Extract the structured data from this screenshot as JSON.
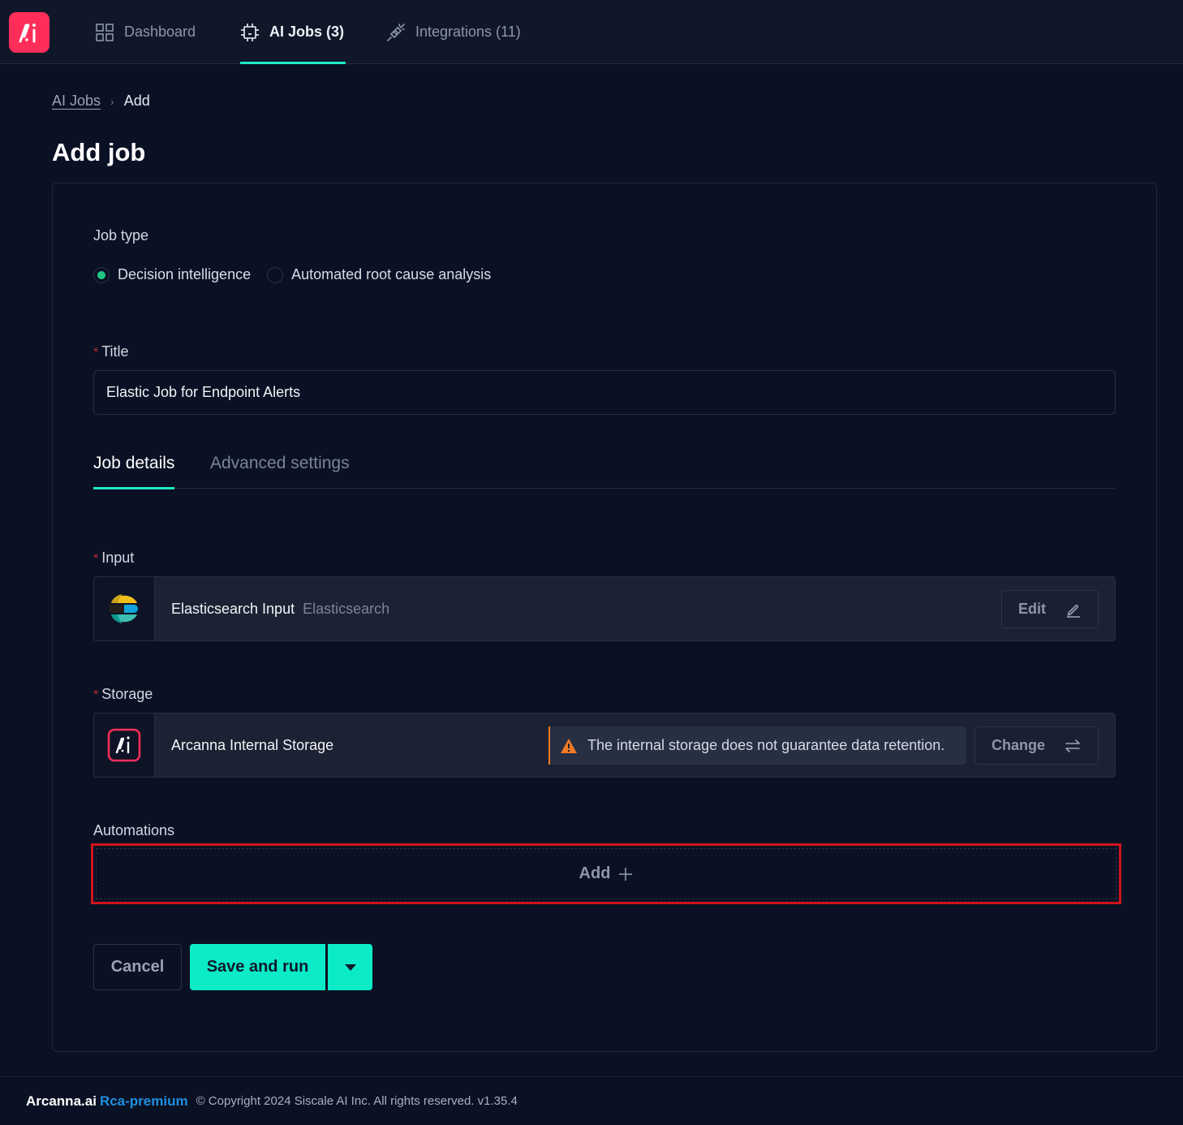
{
  "nav": {
    "items": [
      {
        "label": "Dashboard",
        "icon": "dashboard-grid-icon",
        "active": false
      },
      {
        "label": "AI Jobs (3)",
        "icon": "chip-icon",
        "active": true
      },
      {
        "label": "Integrations (11)",
        "icon": "plug-icon",
        "active": false
      }
    ]
  },
  "breadcrumb": {
    "parent": "AI Jobs",
    "current": "Add"
  },
  "page": {
    "title": "Add job"
  },
  "form": {
    "job_type": {
      "label": "Job type",
      "options": [
        {
          "label": "Decision intelligence",
          "selected": true
        },
        {
          "label": "Automated root cause analysis",
          "selected": false
        }
      ]
    },
    "title": {
      "label": "Title",
      "required_mark": "*",
      "value": "Elastic Job for Endpoint Alerts"
    },
    "tabs": [
      {
        "label": "Job details",
        "active": true
      },
      {
        "label": "Advanced settings",
        "active": false
      }
    ],
    "input": {
      "label": "Input",
      "required_mark": "*",
      "name": "Elasticsearch Input",
      "type": "Elasticsearch",
      "edit_label": "Edit"
    },
    "storage": {
      "label": "Storage",
      "required_mark": "*",
      "name": "Arcanna Internal Storage",
      "warning": "The internal storage does not guarantee data retention.",
      "change_label": "Change"
    },
    "automations": {
      "label": "Automations",
      "add_label": "Add"
    },
    "actions": {
      "cancel_label": "Cancel",
      "save_label": "Save and run"
    }
  },
  "footer": {
    "brand": "Arcanna.ai",
    "plan": "Rca-premium",
    "copyright": "© Copyright 2024 Siscale AI Inc. All rights reserved. v1.35.4"
  },
  "colors": {
    "accent": "#1de9c6",
    "primary_button": "#0bebc8",
    "brand": "#ff2d5a",
    "warning": "#f07a25",
    "highlight": "#d0141c"
  }
}
